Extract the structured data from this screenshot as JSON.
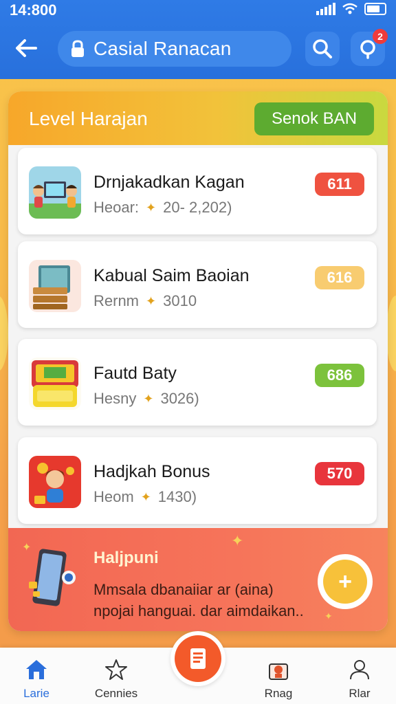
{
  "status": {
    "time": "14:800"
  },
  "header": {
    "title": "Casial Ranacan",
    "notification_count": "2"
  },
  "panel": {
    "title": "Level Harajan",
    "action_label": "Senok BAN"
  },
  "items": [
    {
      "name": "Drnjakadkan Kagan",
      "sub_label": "Heoar:",
      "sub_value": "20- 2,202)",
      "points": "611",
      "points_color": "#ef5240"
    },
    {
      "name": "Kabual Saim Baoian",
      "sub_label": "Rernm",
      "sub_value": "3010",
      "points": "616",
      "points_color": "#f8cc70"
    },
    {
      "name": "Fautd Baty",
      "sub_label": "Hesny",
      "sub_value": "3026)",
      "points": "686",
      "points_color": "#7cc23c"
    },
    {
      "name": "Hadjkah Bonus",
      "sub_label": "Heom",
      "sub_value": "1430)",
      "points": "570",
      "points_color": "#e8353c"
    }
  ],
  "promo": {
    "title": "Haljpuni",
    "description": "Mmsala dbanaiiar ar (aina) npojai hanguai. dar aimdaikan.."
  },
  "nav": {
    "items": [
      {
        "label": "Larie",
        "icon": "home-icon"
      },
      {
        "label": "Cennies",
        "icon": "star-icon"
      },
      {
        "label": "Rnag",
        "icon": "gift-icon"
      },
      {
        "label": "Rlar",
        "icon": "person-icon"
      }
    ],
    "center_icon": "document-icon"
  }
}
